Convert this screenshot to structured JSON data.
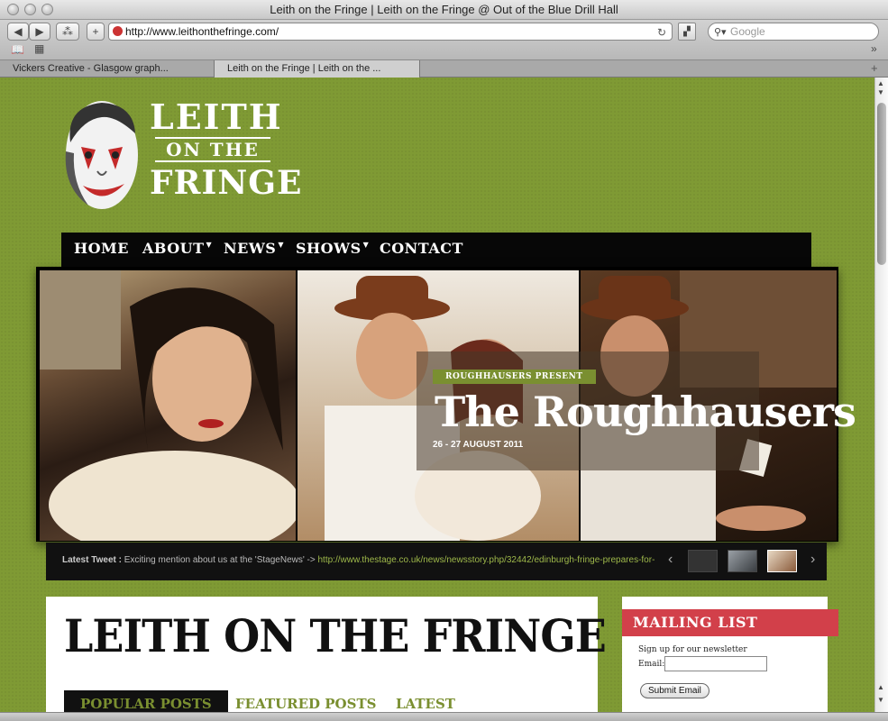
{
  "window": {
    "title": "Leith on the Fringe | Leith on the Fringe @ Out of the Blue Drill Hall"
  },
  "toolbar": {
    "url": "http://www.leithonthefringe.com/",
    "search_placeholder": "Google",
    "reload_icon": "reload-icon"
  },
  "tabs": [
    {
      "label": "Vickers Creative - Glasgow graph..."
    },
    {
      "label": "Leith on the Fringe | Leith on the ..."
    }
  ],
  "logo": {
    "line1": "LEITH",
    "line2": "ON THE",
    "line3": "FRINGE"
  },
  "nav": {
    "items": [
      {
        "label": "HOME",
        "has_dropdown": false
      },
      {
        "label": "ABOUT",
        "has_dropdown": true
      },
      {
        "label": "NEWS",
        "has_dropdown": true
      },
      {
        "label": "SHOWS",
        "has_dropdown": true
      },
      {
        "label": "CONTACT",
        "has_dropdown": false
      }
    ]
  },
  "slider": {
    "kicker": "ROUGHHAUSERS PRESENT",
    "title": "The Roughhausers",
    "date": "26 - 27 AUGUST 2011"
  },
  "tweetbar": {
    "label": "Latest Tweet :",
    "text": " Exciting mention about us at the 'StageNews' -> ",
    "link": "http://www.thestage.co.uk/news/newsstory.php/32442/edinburgh-fringe-prepares-for-"
  },
  "content": {
    "heading": "LEITH ON THE FRINGE",
    "tabs": [
      "POPULAR POSTS",
      "FEATURED POSTS",
      "LATEST"
    ]
  },
  "sidebar": {
    "heading": "MAILING LIST",
    "subtitle": "Sign up for our newsletter",
    "email_label": "Email:",
    "submit_label": "Submit Email"
  },
  "colors": {
    "page_bg": "#7f9a34",
    "nav_bg": "#070707",
    "accent_red": "#d2404a",
    "accent_green": "#7a8f30"
  }
}
